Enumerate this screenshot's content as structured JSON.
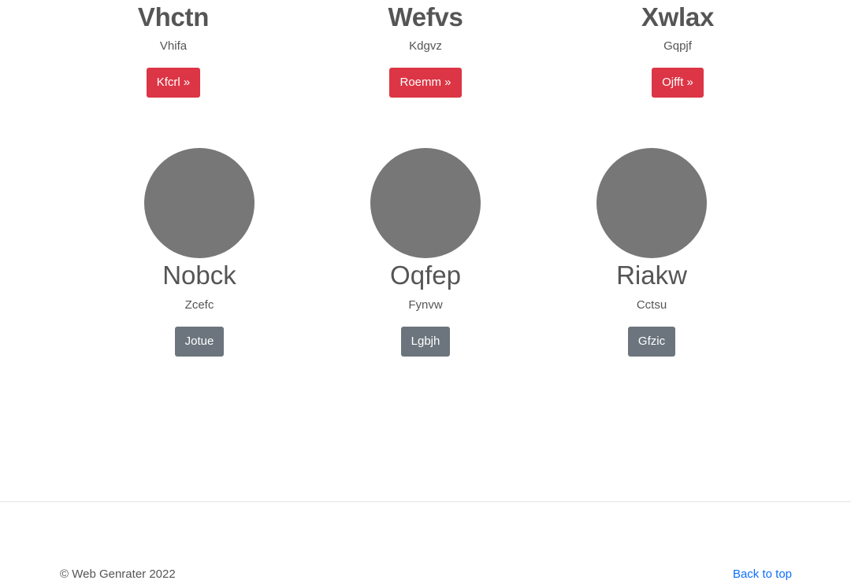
{
  "features": [
    {
      "title": "Vhctn",
      "text": "Vhifa",
      "button": "Kfcrl »"
    },
    {
      "title": "Wefvs",
      "text": "Kdgvz",
      "button": "Roemm »"
    },
    {
      "title": "Xwlax",
      "text": "Gqpjf",
      "button": "Ojfft »"
    }
  ],
  "marketing": [
    {
      "title": "Nobck",
      "text": "Zcefc",
      "button": "Jotue"
    },
    {
      "title": "Oqfep",
      "text": "Fynvw",
      "button": "Lgbjh"
    },
    {
      "title": "Riakw",
      "text": "Cctsu",
      "button": "Gfzic"
    }
  ],
  "footer": {
    "copyright": "© Web Genrater 2022",
    "back_to_top": "Back to top"
  },
  "colors": {
    "danger": "#dc3545",
    "secondary": "#6c757d",
    "placeholder": "#777777",
    "link": "#0d6efd"
  }
}
